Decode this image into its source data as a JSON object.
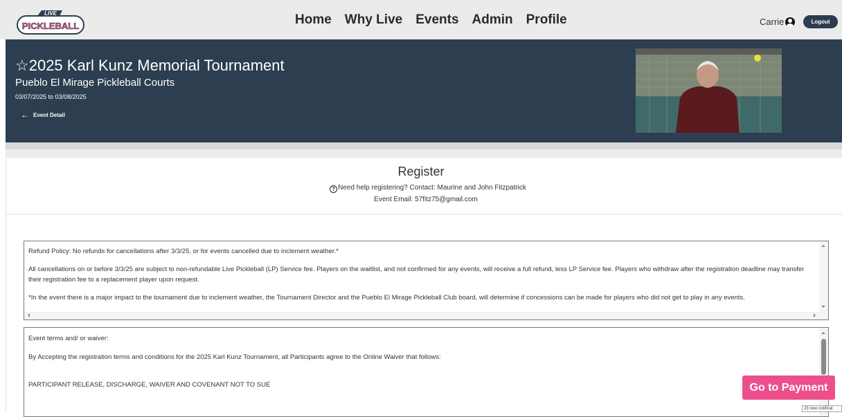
{
  "header": {
    "logo_top": "LIVE",
    "logo_main": "PICKLEBALL",
    "nav": [
      "Home",
      "Why Live",
      "Events",
      "Admin",
      "Profile"
    ],
    "user_name": "Carrie",
    "logout_label": "Logout"
  },
  "event": {
    "title": "☆2025 Karl Kunz Memorial Tournament",
    "venue": "Pueblo El Mirage Pickleball Courts",
    "dates": "03/07/2025 to 03/08/2025",
    "back_label": "Event Detail"
  },
  "register": {
    "title": "Register",
    "help_text": "Need help registering? Contact: Maurine and John Fitzpatrick",
    "email_line": "Event Email: 57fitz75@gmail.com"
  },
  "policy": {
    "paragraphs": [
      "Refund Policy: No refunds for cancellations after 3/3/25, or for events cancelled due to inclement weather.*",
      "All cancellations on or before 3/3/25 are subject to non-refundable Live Pickleball (LP) Service fee. Players on the waitlist, and not confirmed for any events, will receive a full refund, less LP Service fee. Players who withdraw after the registration deadline may transfer their registration fee to a replacement player upon request.",
      "*In the event there is a major impact to the tournament due to inclement weather, the Tournament Director and the Pueblo El Mirage Pickleball Club board, will determine if concessions can be made for players who did not get to play in any events."
    ]
  },
  "terms": {
    "paragraphs": [
      "Event terms and/ or waiver:",
      "By Accepting the registration terms and conditions for the 2025 Karl Kunz Tournament, all Participants agree to the Online Waiver that follows:",
      "PARTICIPANT RELEASE, DISCHARGE, WAIVER AND COVENANT NOT TO SUE"
    ]
  },
  "payment_label": "Go to Payment",
  "notification": "23 new notificat",
  "colors": {
    "banner": "#2c3e50",
    "accent_pink": "#ec4f8c",
    "logout": "#2b3d4e"
  }
}
